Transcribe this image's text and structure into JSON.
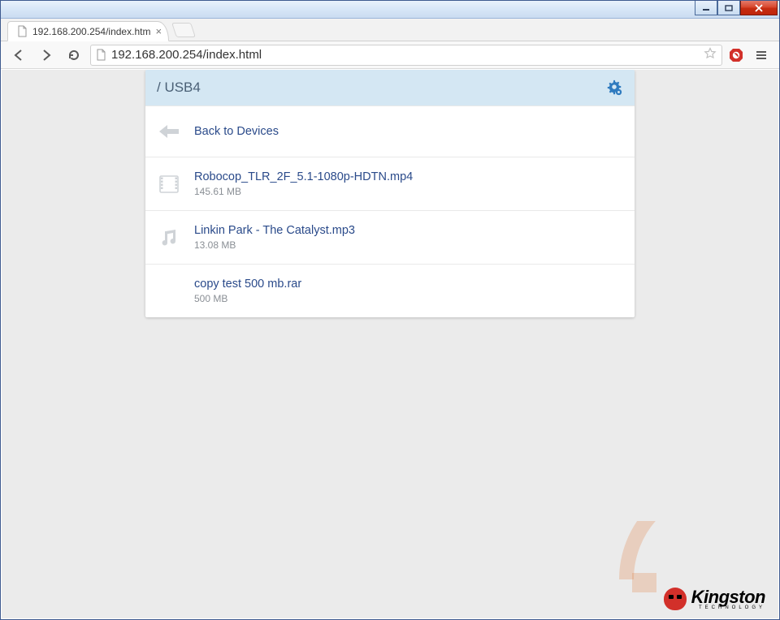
{
  "window": {
    "tab_title": "192.168.200.254/index.htm",
    "url": "192.168.200.254/index.html"
  },
  "panel": {
    "breadcrumb": "/ USB4",
    "back_label": "Back to Devices"
  },
  "files": [
    {
      "name": "Robocop_TLR_2F_5.1-1080p-HDTN.mp4",
      "size": "145.61 MB",
      "kind": "video"
    },
    {
      "name": "Linkin Park - The Catalyst.mp3",
      "size": "13.08 MB",
      "kind": "audio"
    },
    {
      "name": "copy test 500 mb.rar",
      "size": "500 MB",
      "kind": "archive"
    }
  ],
  "watermark": {
    "brand": "Kingston",
    "tagline": "TECHNOLOGY"
  }
}
